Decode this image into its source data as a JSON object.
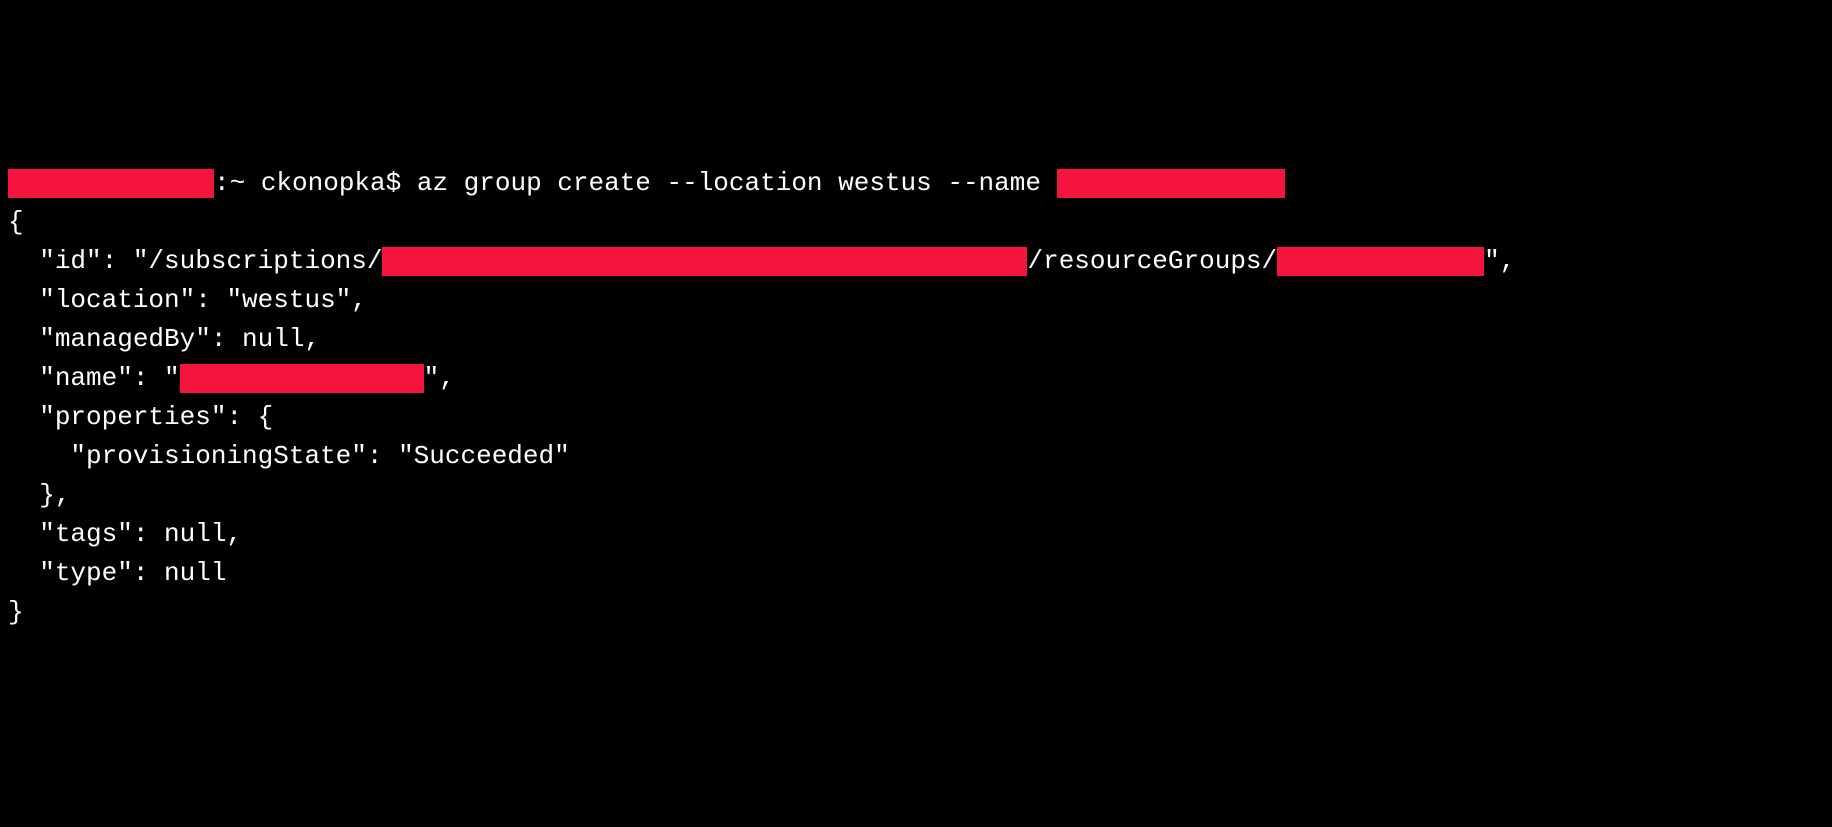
{
  "prompt": {
    "separator_path": ":~ ",
    "user": "ckonopka",
    "prompt_char": "$ ",
    "command": "az group create --location westus --name "
  },
  "output": {
    "brace_open": "{",
    "indent1": "  ",
    "indent2": "    ",
    "id_key": "\"id\": \"/subscriptions/",
    "id_mid": "/resourceGroups/",
    "id_end": "\",",
    "location_line": "\"location\": \"westus\",",
    "managedBy_line": "\"managedBy\": null,",
    "name_key": "\"name\": \"",
    "name_end": "\",",
    "properties_open": "\"properties\": {",
    "provisioning_line": "\"provisioningState\": \"Succeeded\"",
    "properties_close": "},",
    "tags_line": "\"tags\": null,",
    "type_line": "\"type\": null",
    "brace_close": "}"
  }
}
